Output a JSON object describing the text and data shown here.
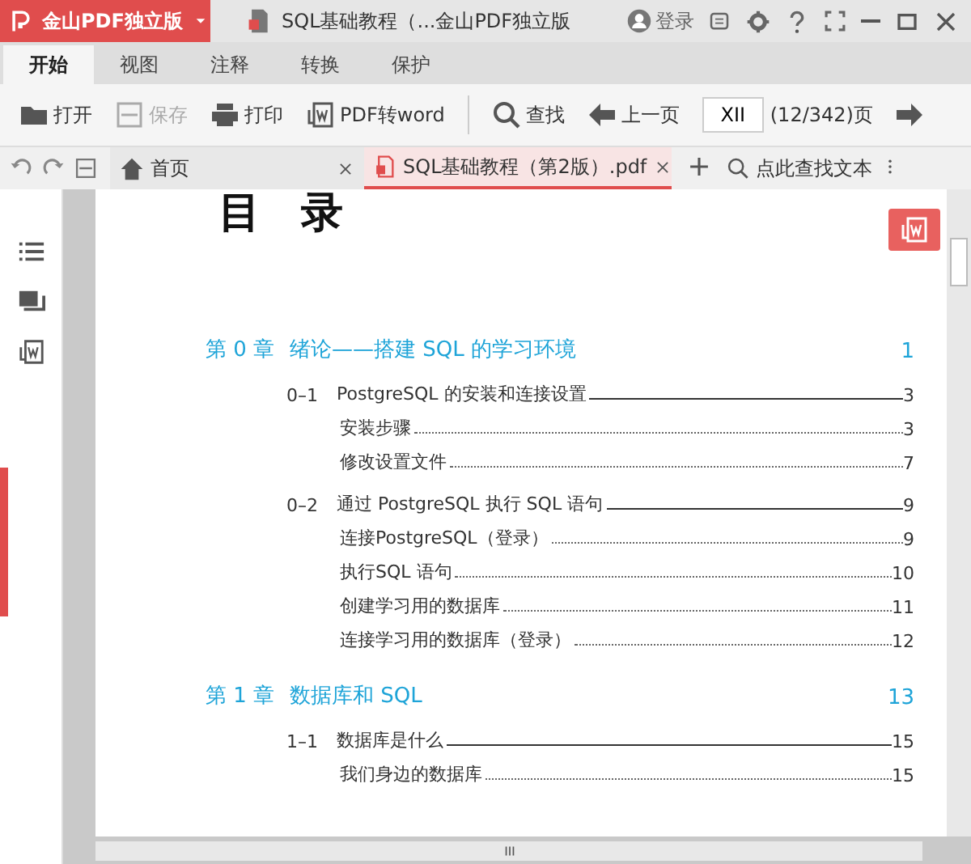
{
  "title_bar": {
    "app_name": "金山PDF独立版",
    "document_title": "SQL基础教程（...金山PDF独立版",
    "login_label": "登录"
  },
  "ribbon_tabs": [
    {
      "label": "开始",
      "selected": true
    },
    {
      "label": "视图",
      "selected": false
    },
    {
      "label": "注释",
      "selected": false
    },
    {
      "label": "转换",
      "selected": false
    },
    {
      "label": "保护",
      "selected": false
    }
  ],
  "toolbar": [
    {
      "kind": "open",
      "label": "打开",
      "disabled": false
    },
    {
      "kind": "save",
      "label": "保存",
      "disabled": true
    },
    {
      "kind": "print",
      "label": "打印",
      "disabled": false
    },
    {
      "kind": "convert",
      "label": "PDF转word",
      "disabled": false
    },
    {
      "kind": "find",
      "label": "查找",
      "disabled": false
    },
    {
      "kind": "prev",
      "label": "上一页",
      "disabled": false
    }
  ],
  "page_field": {
    "value": "XII",
    "count": "(12/342)页"
  },
  "doc_tabs": [
    {
      "kind": "home",
      "label": "首页",
      "selected": false
    },
    {
      "kind": "pdf",
      "label": "SQL基础教程（第2版）.pdf",
      "selected": true
    }
  ],
  "search": {
    "placeholder": "点此查找文本"
  },
  "page": {
    "heading": "目 录",
    "toc": [
      {
        "kind": "chapter",
        "number": "第 0 章",
        "title": "绪论——搭建 SQL 的学习环境",
        "page": "1"
      },
      {
        "kind": "section",
        "number": "0–1",
        "title": "PostgreSQL 的安装和连接设置",
        "page": "3"
      },
      {
        "kind": "item",
        "title": "安装步骤",
        "page": "3"
      },
      {
        "kind": "item",
        "title": "修改设置文件",
        "page": "7"
      },
      {
        "kind": "section",
        "number": "0–2",
        "title": "通过 PostgreSQL 执行 SQL 语句",
        "page": "9"
      },
      {
        "kind": "item",
        "title": "连接PostgreSQL（登录）",
        "page": "9"
      },
      {
        "kind": "item",
        "title": "执行SQL 语句",
        "page": "10"
      },
      {
        "kind": "item",
        "title": "创建学习用的数据库",
        "page": "11"
      },
      {
        "kind": "item",
        "title": "连接学习用的数据库（登录）",
        "page": "12"
      },
      {
        "kind": "chapter",
        "number": "第 1 章",
        "title": "数据库和 SQL",
        "page": "13"
      },
      {
        "kind": "section",
        "number": "1–1",
        "title": "数据库是什么",
        "page": "15"
      },
      {
        "kind": "item",
        "title": "我们身边的数据库",
        "page": "15"
      }
    ]
  }
}
